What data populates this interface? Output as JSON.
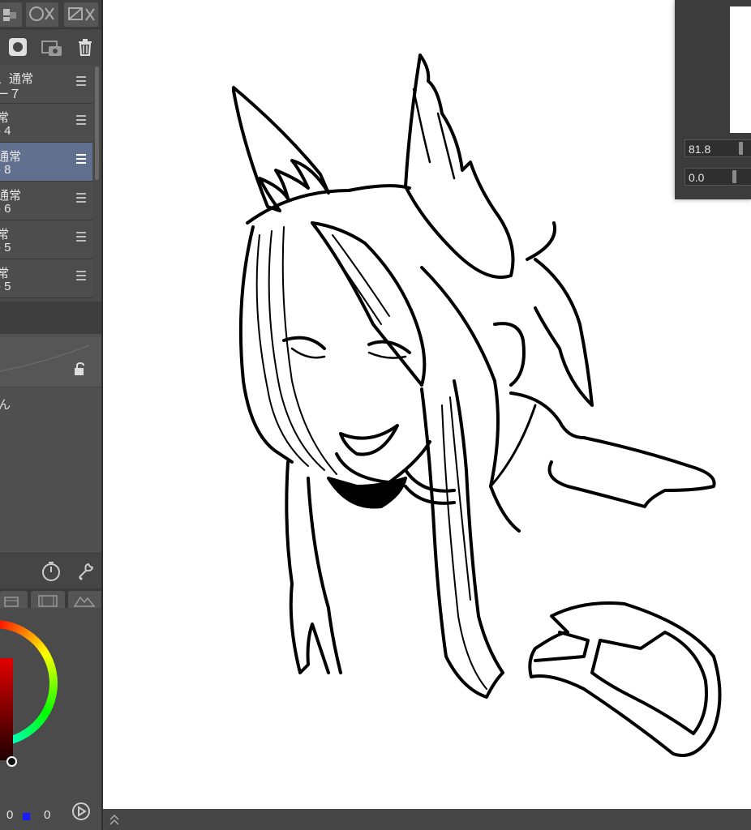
{
  "layers": [
    {
      "line1": "、通常",
      "line2": "ー７"
    },
    {
      "line1": "常",
      "line2": "- 4"
    },
    {
      "line1": "通常",
      "line2": "- 8",
      "selected": true
    },
    {
      "line1": "通常",
      "line2": "- 6"
    },
    {
      "line1": "常",
      "line2": "- 5"
    },
    {
      "line1": "常",
      "line2": "- 5"
    }
  ],
  "properties": {
    "text": "ん"
  },
  "color": {
    "value_left": "0",
    "value_right": "0",
    "swatch_color": "#1a1aff"
  },
  "navigator": {
    "zoom": "81.8",
    "rotation": "0.0"
  },
  "accent": {
    "selected_layer": "#60708e",
    "hue_ring": "conic"
  },
  "icons": {
    "topbar": [
      "layer-mask-icon",
      "clip-icon",
      "transform-icon"
    ],
    "layer_tools": [
      "new-layer-icon",
      "folder-layer-icon",
      "delete-layer-icon"
    ],
    "bottom_tools": [
      "timer-icon",
      "wrench-icon"
    ],
    "tabs": [
      "panel-tab-icon",
      "film-tab-icon",
      "mountain-tab-icon"
    ],
    "status": "expand-chevron-icon"
  }
}
